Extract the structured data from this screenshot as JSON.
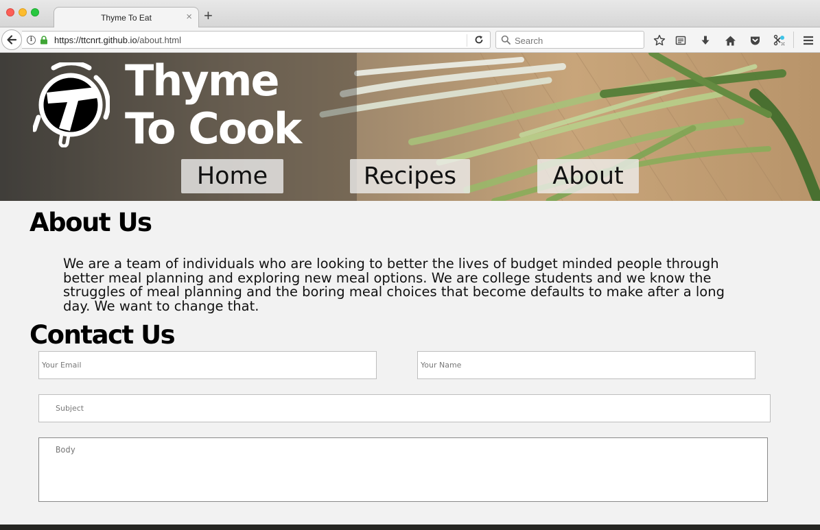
{
  "browser": {
    "tab_title": "Thyme To Eat",
    "tab_close": "×",
    "new_tab": "+",
    "url_host": "https://ttcnrt.github.io",
    "url_path": "/about.html",
    "search_placeholder": "Search"
  },
  "site": {
    "brand_line1": "Thyme",
    "brand_line2": "To Cook",
    "nav": [
      {
        "label": "Home"
      },
      {
        "label": "Recipes"
      },
      {
        "label": "About"
      }
    ]
  },
  "about": {
    "heading": "About Us",
    "body": "We are a team of individuals who are looking to better the lives of budget minded people through better meal planning and exploring new meal options. We are college students and we know the struggles of meal planning and the boring meal choices that become defaults to make after a long day. We want to change that."
  },
  "contact": {
    "heading": "Contact Us",
    "email_placeholder": "Your Email",
    "name_placeholder": "Your Name",
    "subject_placeholder": "Subject",
    "body_placeholder": "Body"
  },
  "colors": {
    "page_bg": "#f2f2f2",
    "footer": "#262622",
    "nav_button_bg": "#eeeeee",
    "brand_text": "#ffffff"
  }
}
